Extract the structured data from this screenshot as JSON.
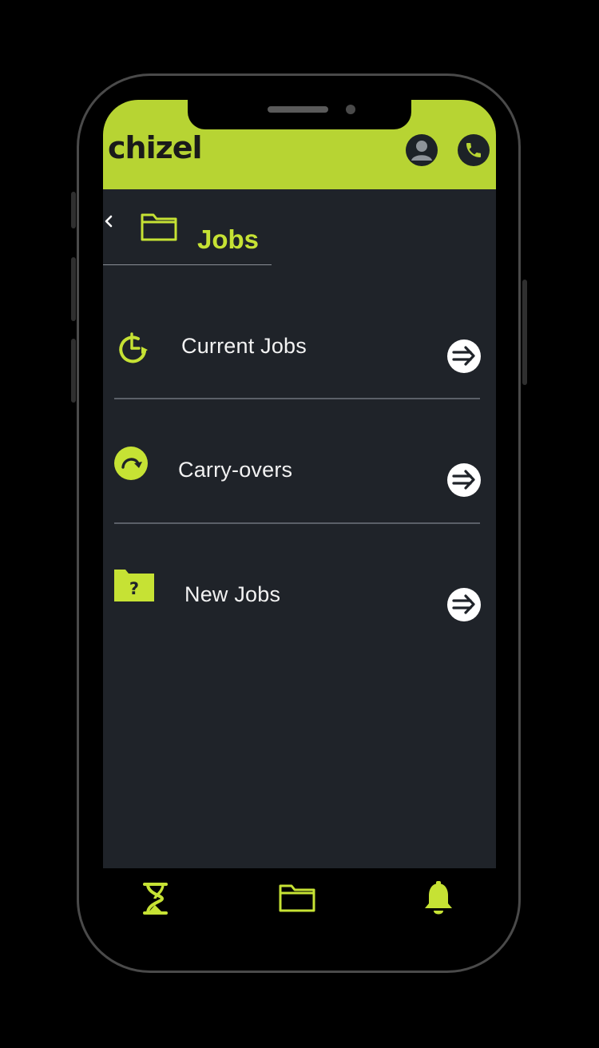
{
  "app": {
    "brand": "chizel",
    "accent_color": "#b7d433",
    "background_color": "#1f2329"
  },
  "header": {
    "profile_icon": "user-avatar-icon",
    "call_icon": "phone-icon"
  },
  "page": {
    "back_icon": "chevron-left-icon",
    "title_icon": "folder-icon",
    "title": "Jobs"
  },
  "menu": {
    "items": [
      {
        "label": "Current Jobs",
        "icon": "clock-refresh-icon",
        "action_icon": "arrow-right-circle-icon"
      },
      {
        "label": "Carry-overs",
        "icon": "redo-circle-icon",
        "action_icon": "arrow-right-circle-icon"
      },
      {
        "label": "New Jobs",
        "icon": "question-folder-icon",
        "action_icon": "arrow-right-circle-icon"
      }
    ]
  },
  "bottom_nav": {
    "items": [
      {
        "icon": "hourglass-icon"
      },
      {
        "icon": "folder-icon"
      },
      {
        "icon": "bell-icon"
      }
    ]
  }
}
